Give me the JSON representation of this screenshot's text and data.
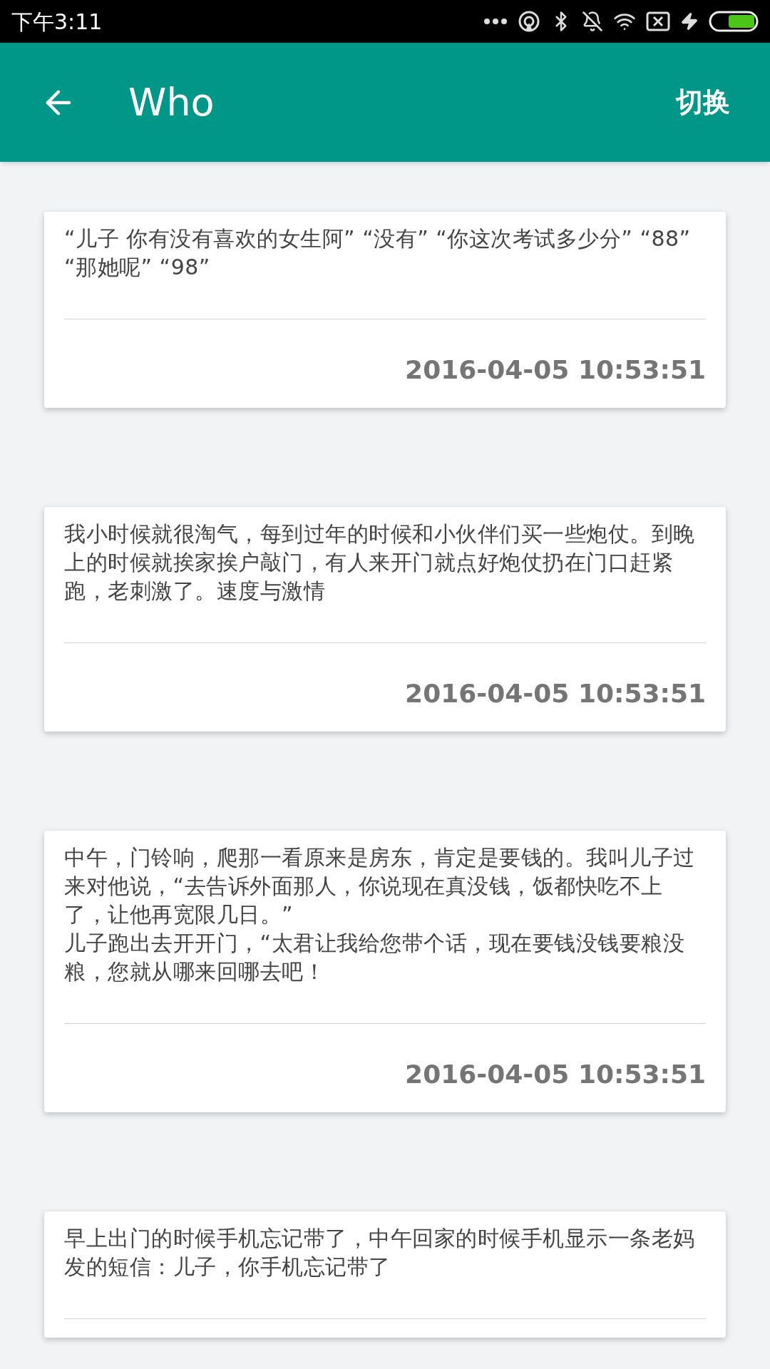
{
  "status_bar": {
    "time": "下午3:11"
  },
  "app_bar": {
    "title": "Who",
    "action": "切换"
  },
  "cards": [
    {
      "text": "“儿子 你有没有喜欢的女生阿” “没有” “你这次考试多少分” “88” “那她呢” “98”",
      "timestamp": "2016-04-05 10:53:51"
    },
    {
      "text": "我小时候就很淘气，每到过年的时候和小伙伴们买一些炮仗。到晚上的时候就挨家挨户敲门，有人来开门就点好炮仗扔在门口赶紧跑，老刺激了。速度与激情",
      "timestamp": "2016-04-05 10:53:51"
    },
    {
      "text": "中午，门铃响，爬那一看原来是房东，肯定是要钱的。我叫儿子过来对他说，“去告诉外面那人，你说现在真没钱，饭都快吃不上了，让他再宽限几日。”\n儿子跑出去开开门，“太君让我给您带个话，现在要钱没钱要粮没粮，您就从哪来回哪去吧！",
      "timestamp": "2016-04-05 10:53:51"
    },
    {
      "text": "早上出门的时候手机忘记带了，中午回家的时候手机显示一条老妈发的短信：儿子，你手机忘记带了"
    }
  ]
}
